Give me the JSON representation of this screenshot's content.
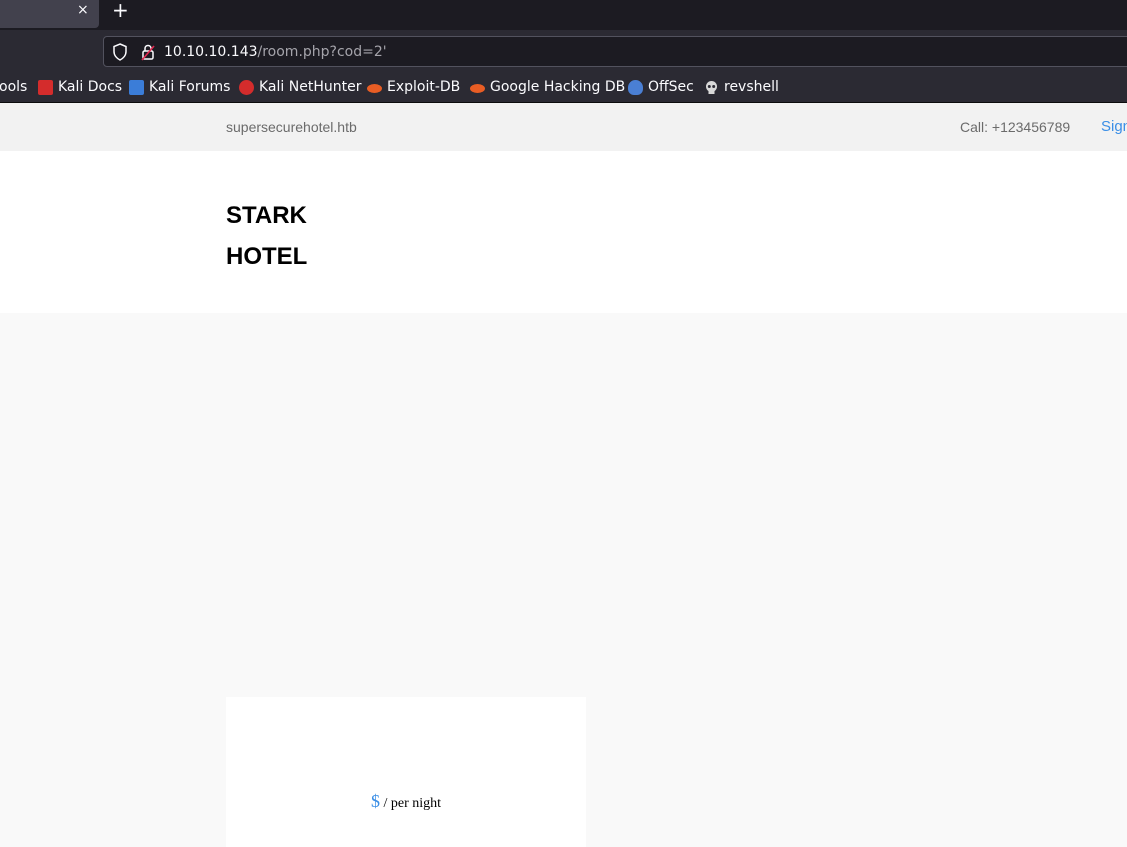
{
  "browser": {
    "tab_close_glyph": "×",
    "new_tab_glyph": "+",
    "url_host": "10.10.10.143",
    "url_path": "/room.php?cod=2'"
  },
  "bookmarks": [
    {
      "label": "ools",
      "icon": "tools-icon",
      "color": "#2b2a33"
    },
    {
      "label": "Kali Docs",
      "icon": "kali-docs-icon",
      "color": "#d42c2c"
    },
    {
      "label": "Kali Forums",
      "icon": "kali-forums-icon",
      "color": "#3b7dd8"
    },
    {
      "label": "Kali NetHunter",
      "icon": "kali-nethunter-icon",
      "color": "#d42c2c"
    },
    {
      "label": "Exploit-DB",
      "icon": "exploit-db-icon",
      "color": "#e85d24"
    },
    {
      "label": "Google Hacking DB",
      "icon": "ghdb-icon",
      "color": "#e85d24"
    },
    {
      "label": "OffSec",
      "icon": "offsec-icon",
      "color": "#4a7fd4"
    },
    {
      "label": "revshell",
      "icon": "skull-icon",
      "color": "#d8d8d8"
    }
  ],
  "site": {
    "name": "supersecurehotel.htb",
    "call": "Call: +123456789",
    "signin": "Sign",
    "logo_line1": "STARK",
    "logo_line2": "HOTEL"
  },
  "room": {
    "currency": "$",
    "per_night": " / per night"
  }
}
